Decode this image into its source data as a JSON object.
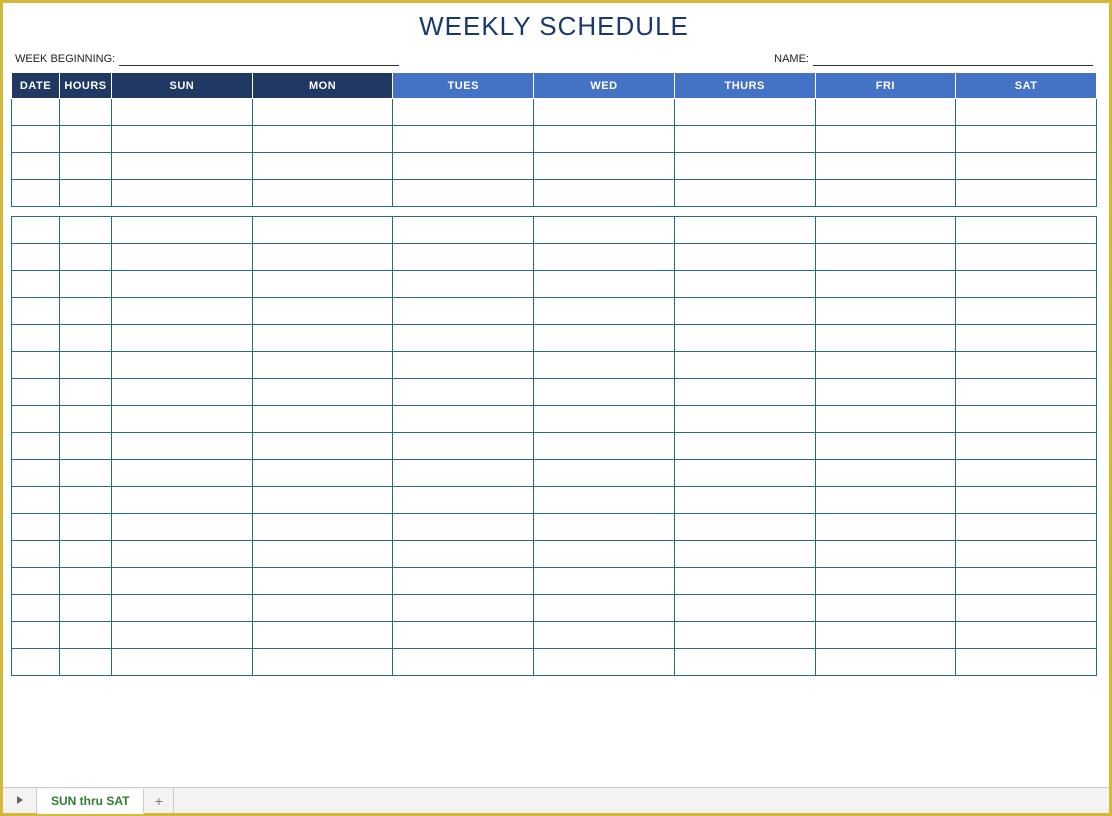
{
  "title": "WEEKLY SCHEDULE",
  "meta": {
    "week_beginning_label": "WEEK BEGINNING:",
    "week_beginning_value": "",
    "name_label": "NAME:",
    "name_value": ""
  },
  "headers": {
    "date": "DATE",
    "hours": "HOURS",
    "days": [
      "SUN",
      "MON",
      "TUES",
      "WED",
      "THURS",
      "FRI",
      "SAT"
    ]
  },
  "row_count": 21,
  "spacer_after": [
    4
  ],
  "sheet_tab": "SUN thru SAT",
  "add_symbol": "+"
}
